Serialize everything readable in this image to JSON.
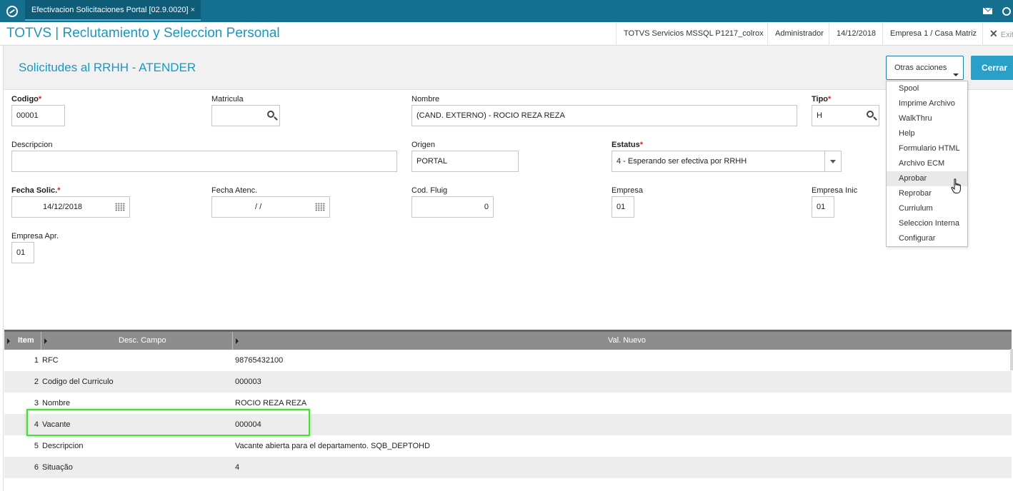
{
  "tabbar": {
    "tab_title": "Efectivacion Solicitaciones Portal [02.9.0020]",
    "tab_close": "×"
  },
  "header": {
    "app_title": "TOTVS | Reclutamiento y Seleccion Personal",
    "environment": "TOTVS Servicios MSSQL P1217_colrox",
    "user": "Administrador",
    "date": "14/12/2018",
    "company": "Empresa 1 / Casa Matriz",
    "exit_label": "Exit"
  },
  "form": {
    "title": "Solicitudes al RRHH - ATENDER",
    "otras_label": "Otras acciones",
    "cerrar_label": "Cerrar",
    "fields": {
      "codigo": {
        "label": "Codigo",
        "value": "00001"
      },
      "matricula": {
        "label": "Matricula",
        "value": ""
      },
      "nombre": {
        "label": "Nombre",
        "value": "(CAND. EXTERNO) - ROCIO REZA REZA"
      },
      "tipo": {
        "label": "Tipo",
        "value": "H"
      },
      "descripcion": {
        "label": "Descripcion",
        "value": ""
      },
      "origen": {
        "label": "Origen",
        "value": "PORTAL"
      },
      "estatus": {
        "label": "Estatus",
        "value": "4 - Esperando ser efectiva por RRHH"
      },
      "fecha_solic": {
        "label": "Fecha Solic.",
        "value": "14/12/2018"
      },
      "fecha_atenc": {
        "label": "Fecha Atenc.",
        "value": "/  /"
      },
      "cod_fluig": {
        "label": "Cod. Fluig",
        "value": "0"
      },
      "empresa": {
        "label": "Empresa",
        "value": "01"
      },
      "empresa_inic": {
        "label": "Empresa Inic",
        "value": "01"
      },
      "empresa_apr": {
        "label": "Empresa Apr.",
        "value": "01"
      }
    },
    "required_mark": "*"
  },
  "menu": {
    "items": [
      "Spool",
      "Imprime Archivo",
      "WalkThru",
      "Help",
      "Formulario HTML",
      "Archivo ECM",
      "Aprobar",
      "Reprobar",
      "Curriulum",
      "Seleccion Interna",
      "Configurar"
    ],
    "hovered_index": 6
  },
  "grid": {
    "columns": [
      "Item",
      "Desc. Campo",
      "Val. Nuevo"
    ],
    "rows": [
      {
        "item": "1",
        "campo": "RFC",
        "valor": "98765432100"
      },
      {
        "item": "2",
        "campo": "Codigo del Curriculo",
        "valor": "000003"
      },
      {
        "item": "3",
        "campo": "Nombre",
        "valor": "ROCIO REZA REZA"
      },
      {
        "item": "4",
        "campo": "Vacante",
        "valor": "000004"
      },
      {
        "item": "5",
        "campo": "Descripcion",
        "valor": "Vacante abierta para el departamento. SQB_DEPTOHD"
      },
      {
        "item": "6",
        "campo": "Situação",
        "valor": "4"
      }
    ],
    "highlighted_row": 3
  }
}
